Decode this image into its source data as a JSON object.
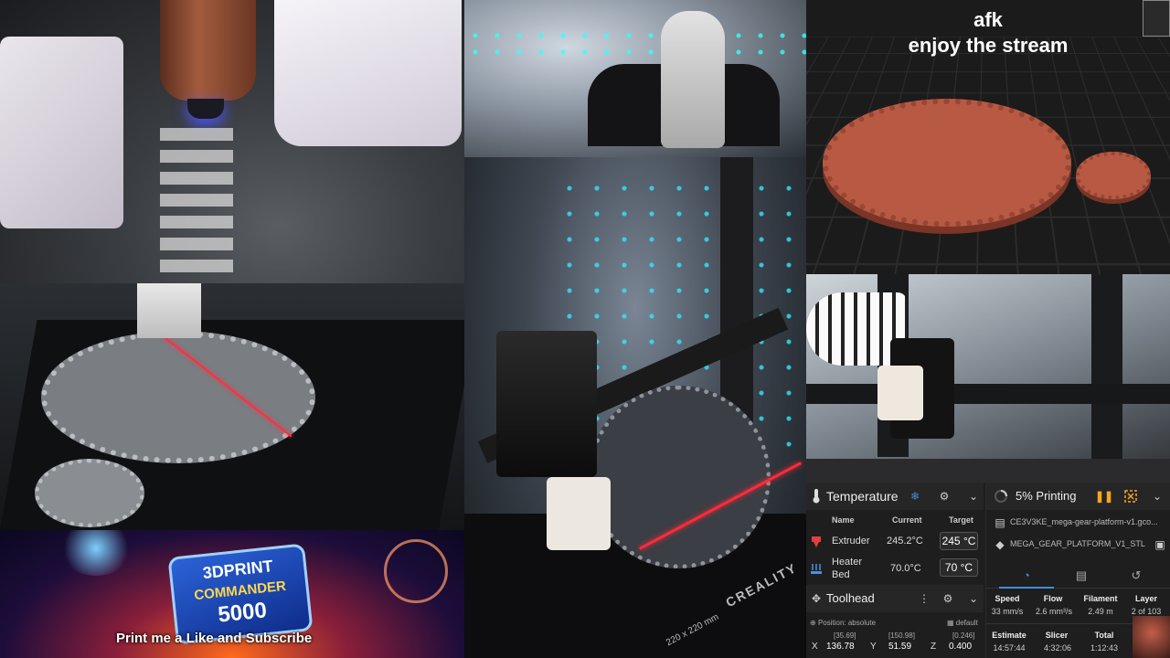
{
  "overlay": {
    "line1": "afk",
    "line2": "enjoy the stream"
  },
  "camera": {
    "brand": "CREALITY",
    "bed_size": "220 x 220  mm"
  },
  "banner": {
    "logo_line1": "3DPRINT",
    "logo_line2": "COMMANDER",
    "logo_line3": "5000",
    "tagline": "Print me a Like and Subscribe"
  },
  "temperature": {
    "title": "Temperature",
    "headers": {
      "name": "Name",
      "current": "Current",
      "target": "Target"
    },
    "rows": [
      {
        "name": "Extruder",
        "current": "245.2°C",
        "target": "245",
        "unit": "°C"
      },
      {
        "name_line1": "Heater",
        "name_line2": "Bed",
        "current": "70.0°C",
        "target": "70",
        "unit": "°C"
      }
    ]
  },
  "toolhead": {
    "title": "Toolhead",
    "position_label": "Position: absolute",
    "default_label": "default",
    "axes": [
      {
        "axis": "X",
        "value": "136.78",
        "target": "[35.69]"
      },
      {
        "axis": "Y",
        "value": "51.59",
        "target": "[150.98]"
      },
      {
        "axis": "Z",
        "value": "0.400",
        "target": "[0.246]"
      }
    ]
  },
  "job": {
    "status": "5% Printing",
    "file": "CE3V3KE_mega-gear-platform-v1.gco...",
    "object": "MEGA_GEAR_PLATFORM_V1_STL",
    "stats": [
      {
        "label": "Speed",
        "value": "33 mm/s"
      },
      {
        "label": "Flow",
        "value": "2.6 mm³/s"
      },
      {
        "label": "Filament",
        "value": "2.49 m"
      },
      {
        "label": "Layer",
        "value": "2 of 103"
      }
    ],
    "times": [
      {
        "label": "Estimate",
        "value": "14:57:44"
      },
      {
        "label": "Slicer",
        "value": "4:32:06"
      },
      {
        "label": "Total",
        "value": "1:12:43"
      }
    ]
  },
  "colors": {
    "accent": "#3f8fd9",
    "pause": "#f5a623",
    "extruder_icon": "#e04040",
    "bed_icon": "#4a90e2"
  },
  "icons": [
    "thermometer-icon",
    "snowflake-icon",
    "gear-icon",
    "chevron-down-icon",
    "toolhead-icon",
    "more-icon",
    "spinner-icon",
    "pause-icon",
    "cancel-icon",
    "file-icon",
    "object-icon",
    "gauge-icon",
    "document-icon",
    "history-icon",
    "home-icon"
  ]
}
